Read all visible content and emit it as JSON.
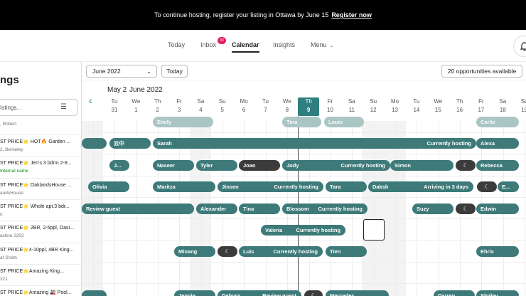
{
  "banner": {
    "text": "To continue hosting, register your listing in Ottawa by June 15",
    "link": "Register now"
  },
  "nav": {
    "today": "Today",
    "inbox": "Inbox",
    "inbox_badge": "33",
    "calendar": "Calendar",
    "insights": "Insights",
    "menu": "Menu"
  },
  "sidebar": {
    "title": "ngs",
    "search_placeholder": "listings...",
    "top_subtitle": ", Robert",
    "listings": [
      {
        "title": "ST PRICE⭐ HOT🔥 Garden ...",
        "subtitle": "2, Berkeley",
        "sub_green": false
      },
      {
        "title": "ST PRICE⭐ Jen's 3 bdrm 2-8...",
        "subtitle": "Internal name",
        "sub_green": true
      },
      {
        "title": "ST PRICE⭐ OaklandsHouse ...",
        "subtitle": "andsHouse",
        "sub_green": false
      },
      {
        "title": "ST PRICE⭐ Whole apt.3 bdr...",
        "subtitle": "n",
        "sub_green": false
      },
      {
        "title": "ST PRICE⭐ 2BR, 2-5ppl, Oasi...",
        "subtitle": "actine 2202",
        "sub_green": false
      },
      {
        "title": "ST PRICE⭐4-10ppl, 4BR King...",
        "subtitle": "af Smith",
        "sub_green": false
      },
      {
        "title": "ST PRICE⭐Amazing King...",
        "subtitle": "321",
        "sub_green": false
      },
      {
        "title": "ST PRICE⭐Amazing 🎎 Pool...",
        "subtitle": "",
        "sub_green": false
      }
    ]
  },
  "toolbar": {
    "month": "June 2022",
    "today": "Today",
    "opportunities": "20 opportunities available"
  },
  "calendar": {
    "month_label_prev": "May 2",
    "month_label": "June 2022",
    "days": [
      {
        "dow": "Tu",
        "num": "31"
      },
      {
        "dow": "We",
        "num": "1"
      },
      {
        "dow": "Th",
        "num": "2"
      },
      {
        "dow": "Fr",
        "num": "3"
      },
      {
        "dow": "Sa",
        "num": "4"
      },
      {
        "dow": "Su",
        "num": "5"
      },
      {
        "dow": "Mo",
        "num": "6"
      },
      {
        "dow": "Tu",
        "num": "7"
      },
      {
        "dow": "We",
        "num": "8"
      },
      {
        "dow": "Th",
        "num": "9"
      },
      {
        "dow": "Fr",
        "num": "10"
      },
      {
        "dow": "Sa",
        "num": "11"
      },
      {
        "dow": "Su",
        "num": "12"
      },
      {
        "dow": "Mo",
        "num": "13"
      },
      {
        "dow": "Tu",
        "num": "14"
      },
      {
        "dow": "We",
        "num": "15"
      },
      {
        "dow": "Th",
        "num": "16"
      },
      {
        "dow": "Fr",
        "num": "17"
      },
      {
        "dow": "Sa",
        "num": "18"
      },
      {
        "dow": "Su",
        "num": "19"
      }
    ],
    "today_index": 9,
    "reservations": [
      "Emily",
      "Tina",
      "Louis",
      "Carlie",
      "云中",
      "Sarah",
      "Currently hosting",
      "Alexa",
      "J...",
      "Naseer",
      "Tyler",
      "Joao",
      "Jody",
      "Currently hosting",
      "Simon",
      "Rebecca",
      "Olivia",
      "Maritza",
      "Jinsen",
      "Currently hosting",
      "Tara",
      "Daksh",
      "Arriving in 3 days",
      "E...",
      "Review guest",
      "Alexander",
      "Tina",
      "Blossom",
      "Currently hosting",
      "Suzy",
      "Edwin",
      "Valeria",
      "Currently hosting",
      "Minang",
      "Luis",
      "Currently hosting",
      "Tien",
      "Ehris",
      "Jennie",
      "Debora",
      "Review guest",
      "Mercedes",
      "Darren",
      "Shidev"
    ]
  }
}
